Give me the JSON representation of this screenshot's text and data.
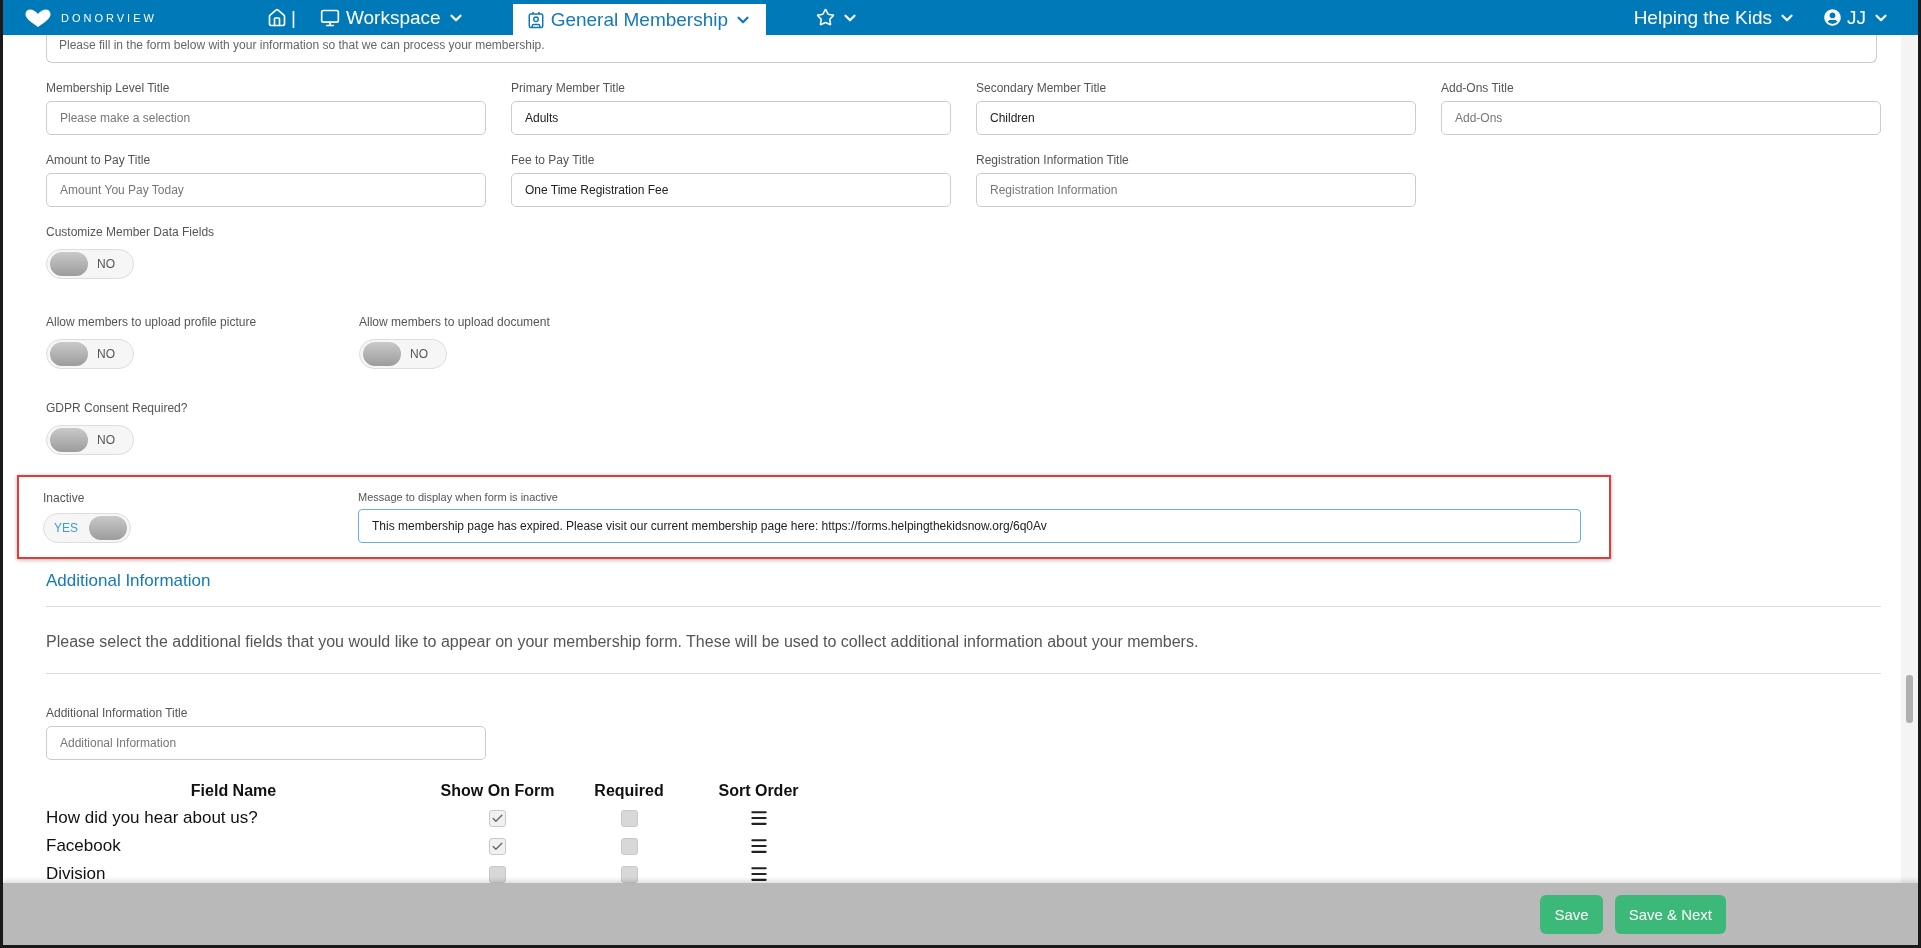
{
  "nav": {
    "logo": "DONORVIEW",
    "separator": "|",
    "items": [
      {
        "kind": "workspace",
        "label": "Workspace",
        "selected": false
      },
      {
        "kind": "membership",
        "label": "General Membership",
        "selected": true
      }
    ],
    "organization": "Helping the Kids",
    "user": "JJ"
  },
  "intro": "Please fill in the form below with your information so that we can process your membership.",
  "field_rows": [
    [
      {
        "label": "Membership Level Title",
        "placeholder": "Please make a selection"
      },
      {
        "label": "Primary Member Title",
        "value": "Adults"
      },
      {
        "label": "Secondary Member Title",
        "value": "Children"
      },
      {
        "label": "Add-Ons Title",
        "placeholder": "Add-Ons"
      }
    ],
    [
      {
        "label": "Amount to Pay Title",
        "placeholder": "Amount You Pay Today"
      },
      {
        "label": "Fee to Pay Title",
        "value": "One Time Registration Fee"
      },
      {
        "label": "Registration Information Title",
        "placeholder": "Registration Information"
      }
    ]
  ],
  "toggle_rows": [
    [
      {
        "label": "Customize Member Data Fields",
        "on": false,
        "text": "NO"
      }
    ],
    [
      {
        "label": "Allow members to upload profile picture",
        "on": false,
        "text": "NO"
      },
      {
        "label": "Allow members to upload document",
        "on": false,
        "text": "NO"
      }
    ],
    [
      {
        "label": "GDPR Consent Required?",
        "on": false,
        "text": "NO"
      }
    ]
  ],
  "inactive": {
    "label": "Inactive",
    "on": true,
    "text": "YES",
    "message_label": "Message to display when form is inactive",
    "message": "This membership page has expired. Please visit our current membership page here: https://forms.helpingthekidsnow.org/6q0Av"
  },
  "additional": {
    "heading": "Additional Information",
    "description": "Please select the additional fields that you would like to appear on your membership form. These will be used to collect additional information about your members.",
    "title_label": "Additional Information Title",
    "title_placeholder": "Additional Information",
    "columns": [
      "Field Name",
      "Show On Form",
      "Required",
      "Sort Order"
    ],
    "rows": [
      {
        "name": "How did you hear about us?",
        "show_on_form": true,
        "required": false
      },
      {
        "name": "Facebook",
        "show_on_form": true,
        "required": false
      },
      {
        "name": "Division",
        "show_on_form": false,
        "required": false
      }
    ]
  },
  "footer_buttons": [
    "Save",
    "Save & Next"
  ]
}
